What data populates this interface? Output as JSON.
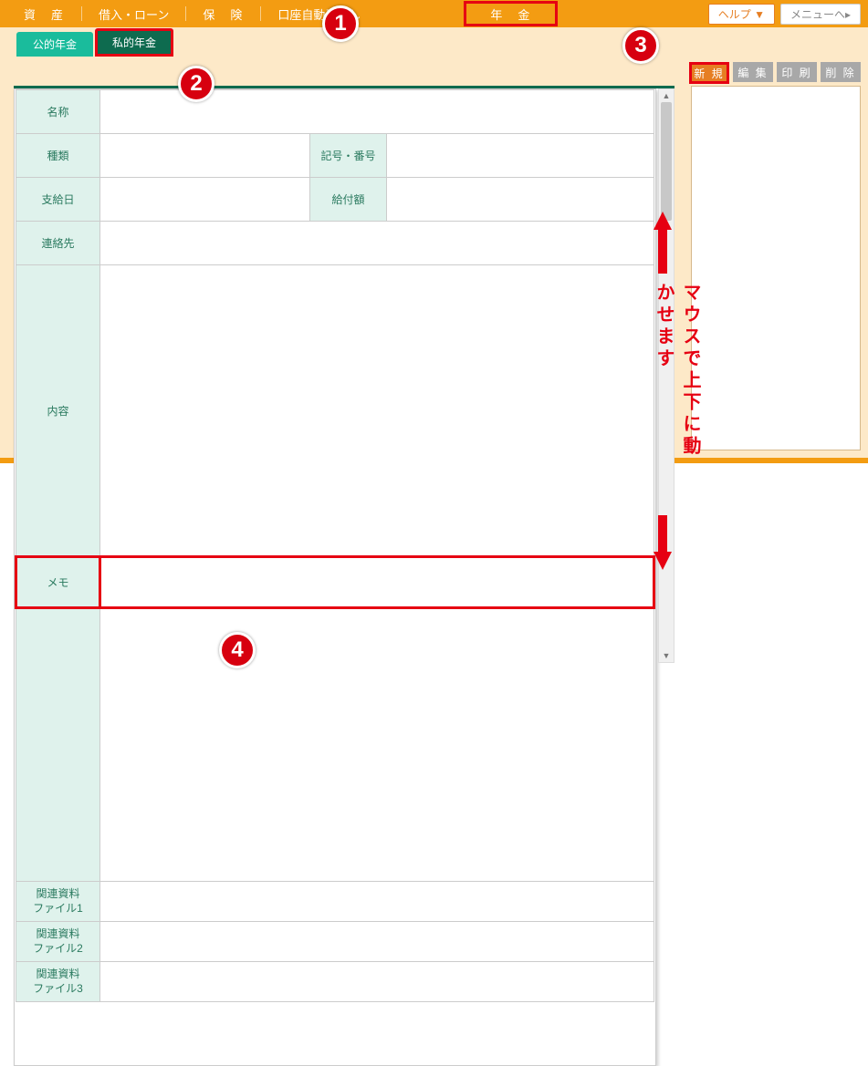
{
  "topnav": {
    "items": [
      "資　産",
      "借入・ローン",
      "保　険",
      "口座自動引落し"
    ],
    "pension": "年　金"
  },
  "topbar": {
    "help": "ヘルプ ▼",
    "menu": "メニューへ▸"
  },
  "tabs": {
    "public": "公的年金",
    "private": "私的年金"
  },
  "sidebuttons": {
    "new": "新 規",
    "edit": "編 集",
    "print": "印 刷",
    "delete": "削 除"
  },
  "form": {
    "name": "名称",
    "type": "種類",
    "symbol_no": "記号・番号",
    "pay_date": "支給日",
    "benefit": "給付額",
    "contact": "連絡先",
    "content": "内容",
    "memo": "メモ",
    "file1": "関連資料\nファイル1",
    "file2": "関連資料\nファイル2",
    "file3": "関連資料\nファイル3"
  },
  "annotations": {
    "c1": "1",
    "c2": "2",
    "c3": "3",
    "c4": "4",
    "scroll_note": "マウスで上下に動かせます"
  }
}
